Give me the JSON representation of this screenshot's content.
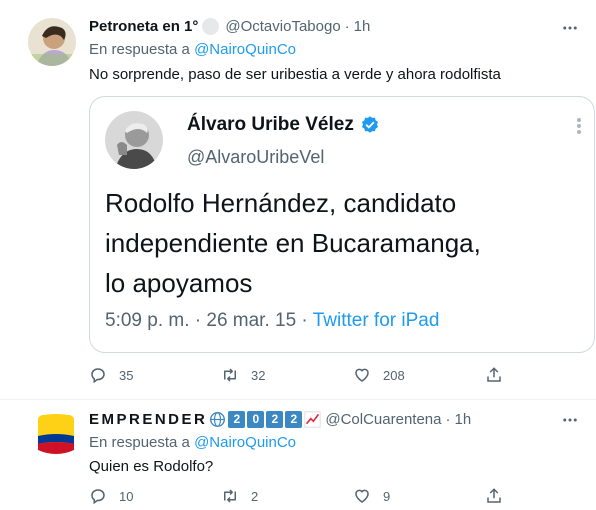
{
  "tweet1": {
    "author_name": "Petroneta en 1°",
    "author_handle": "@OctavioTabogo",
    "time": "1h",
    "separator": "·",
    "replying_prefix": "En respuesta a ",
    "replying_to": "@NairoQuinCo",
    "text": "No sorprende, paso de ser uribestia a verde y ahora rodolfista",
    "quote": {
      "author_name": "Álvaro Uribe Vélez",
      "author_handle": "@AlvaroUribeVel",
      "text_line1": "Rodolfo Hernández, candidato",
      "text_line2": "independiente en Bucaramanga,",
      "text_line3": "lo apoyamos",
      "timestamp": "5:09 p. m. · 26 mar. 15 · ",
      "source": "Twitter for iPad"
    },
    "replies": "35",
    "retweets": "32",
    "likes": "208"
  },
  "tweet2": {
    "author_name": "EMPRENDER",
    "author_digits": [
      "2",
      "0",
      "2",
      "2"
    ],
    "author_handle": "@ColCuarentena",
    "time": "1h",
    "separator": "·",
    "replying_prefix": "En respuesta a ",
    "replying_to": "@NairoQuinCo",
    "text": "Quien es Rodolfo?",
    "replies": "10",
    "retweets": "2",
    "likes": "9"
  },
  "colors": {
    "accent": "#1d9bf0",
    "secondary_text": "#536471",
    "border": "#cfd9de"
  }
}
